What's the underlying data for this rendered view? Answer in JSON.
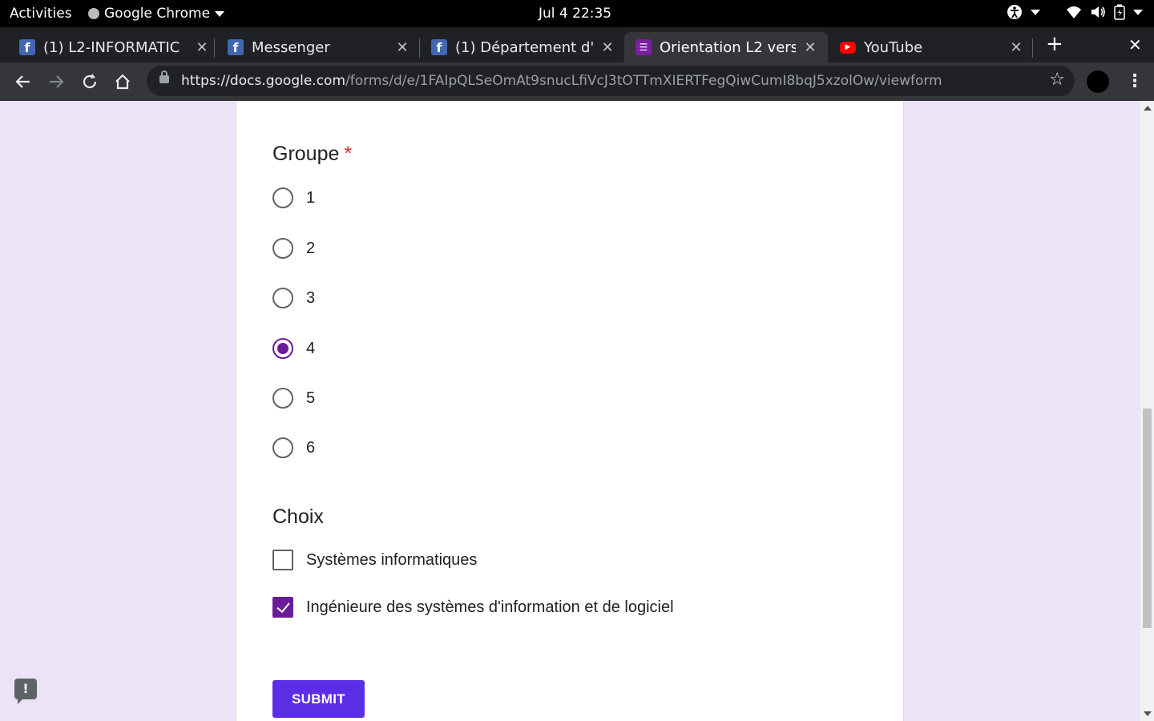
{
  "system_bar": {
    "activities": "Activities",
    "app_name": "Google Chrome",
    "clock": "Jul 4  22:35",
    "icons": [
      "accessibility-icon",
      "wifi-icon",
      "volume-icon",
      "battery-icon"
    ]
  },
  "browser": {
    "tabs": [
      {
        "title": "(1) L2-INFORMATIC",
        "favicon": "facebook-icon",
        "active": false
      },
      {
        "title": "Messenger",
        "favicon": "facebook-icon",
        "active": false
      },
      {
        "title": "(1) Département d'i",
        "favicon": "facebook-icon",
        "active": false
      },
      {
        "title": "Orientation L2 vers",
        "favicon": "forms-icon",
        "active": true
      },
      {
        "title": "YouTube",
        "favicon": "youtube-icon",
        "active": false
      }
    ],
    "url_host": "https://docs.google.com",
    "url_path": "/forms/d/e/1FAIpQLSeOmAt9snucLfiVcJ3tOTTmXIERTFegQiwCumI8bqJ5xzolOw/viewform",
    "colors": {
      "chrome_dark": "#202124",
      "toolbar": "#35363a"
    }
  },
  "form": {
    "group_question": {
      "title": "Groupe",
      "required_mark": "*",
      "options": [
        "1",
        "2",
        "3",
        "4",
        "5",
        "6"
      ],
      "selected": "4"
    },
    "choice_question": {
      "title": "Choix",
      "options": [
        {
          "label": "Systèmes informatiques",
          "checked": false
        },
        {
          "label": "Ingénieure des systèmes d'information et de logiciel",
          "checked": true
        }
      ]
    },
    "submit_label": "SUBMIT",
    "colors": {
      "accent": "#6a1b9a",
      "submit": "#5b2ee6",
      "background": "#ede3f6",
      "required": "#d93025"
    }
  },
  "feedback_icon": "!"
}
